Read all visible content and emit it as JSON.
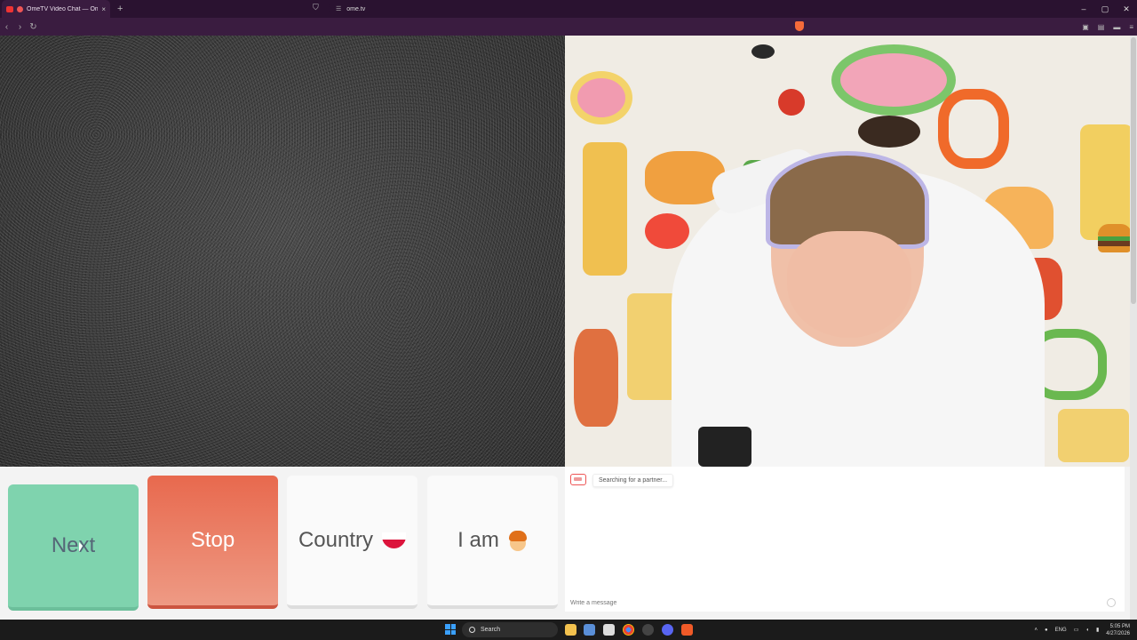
{
  "browser": {
    "tab_title": "OmeTV Video Chat — Omegle",
    "tab_close": "×",
    "new_tab": "+",
    "url": "ome.tv",
    "window_controls": [
      "–",
      "▢",
      "✕"
    ]
  },
  "chat_controls": {
    "next_label": "Next",
    "stop_label": "Stop",
    "country_label": "Country",
    "iam_label": "I am"
  },
  "chat": {
    "status_message": "Searching for a partner...",
    "input_placeholder": "Write a message"
  },
  "taskbar": {
    "search_label": "Search",
    "language": "ENG",
    "time": "5:05 PM",
    "date": "4/27/2026"
  },
  "colors": {
    "next": "#7fd3ae",
    "stop": "#e8694e",
    "browser_chrome": "#3a1c40"
  }
}
